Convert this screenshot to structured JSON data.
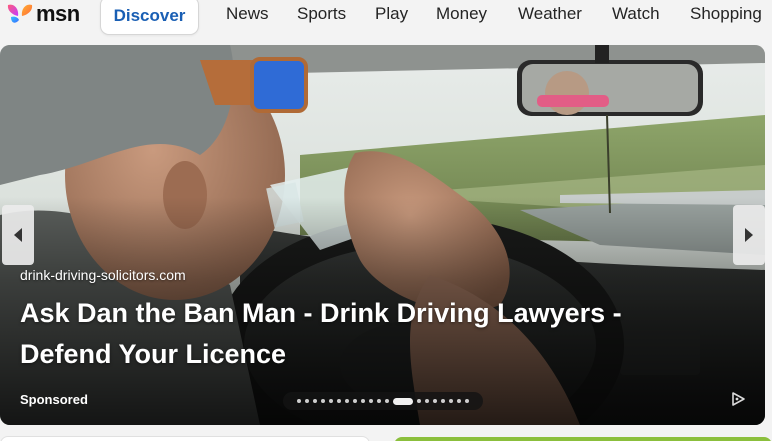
{
  "brand": {
    "name": "msn"
  },
  "nav": {
    "active_tab": "Discover",
    "links": [
      "News",
      "Sports",
      "Play",
      "Money",
      "Weather",
      "Watch",
      "Shopping"
    ]
  },
  "hero": {
    "source": "drink-driving-solicitors.com",
    "headline": "Ask Dan the Ban Man - Drink Driving Lawyers - Defend Your Licence",
    "sponsored_label": "Sponsored",
    "carousel_total": 20,
    "carousel_active_index": 12,
    "image_subject": "man in cap and sunglasses drinking from a water bottle while driving"
  },
  "icons": {
    "prev": "chevron-left-icon",
    "next": "chevron-right-icon",
    "adchoices": "adchoices-icon"
  },
  "colors": {
    "accent": "#1a5fb4",
    "page_bg": "#f3f3f3"
  }
}
